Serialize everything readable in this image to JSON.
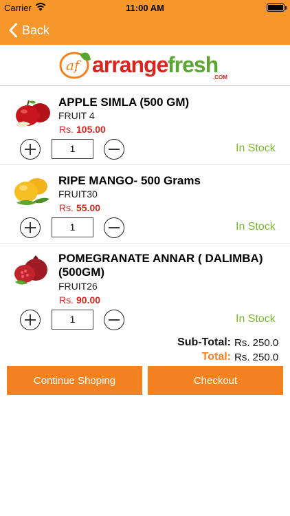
{
  "status_bar": {
    "carrier": "Carrier",
    "time": "11:00 AM"
  },
  "nav": {
    "back_label": "Back"
  },
  "logo": {
    "prefix": "arrange",
    "suffix": "fresh",
    "com": ".COM"
  },
  "products": [
    {
      "name": "APPLE SIMLA (500 GM)",
      "code": "FRUIT 4",
      "currency": "Rs.",
      "price": "105.00",
      "quantity": "1",
      "stock": "In Stock",
      "image": "apple-icon"
    },
    {
      "name": "RIPE MANGO- 500 Grams",
      "code": "FRUIT30",
      "currency": "Rs.",
      "price": "55.00",
      "quantity": "1",
      "stock": "In Stock",
      "image": "mango-icon"
    },
    {
      "name": "POMEGRANATE ANNAR ( DALIMBA) (500GM)",
      "code": "FRUIT26",
      "currency": "Rs.",
      "price": "90.00",
      "quantity": "1",
      "stock": "In Stock",
      "image": "pomegranate-icon"
    }
  ],
  "totals": {
    "subtotal_label": "Sub-Total:",
    "subtotal_value": "Rs.  250.0",
    "total_label": "Total:",
    "total_value": "Rs.  250.0"
  },
  "actions": {
    "continue_label": "Continue Shoping",
    "checkout_label": "Checkout"
  },
  "colors": {
    "brand_orange": "#F7962A",
    "button_orange": "#F58220",
    "price_red": "#D8261E",
    "stock_green": "#7AB92E",
    "logo_green": "#5BA532"
  }
}
